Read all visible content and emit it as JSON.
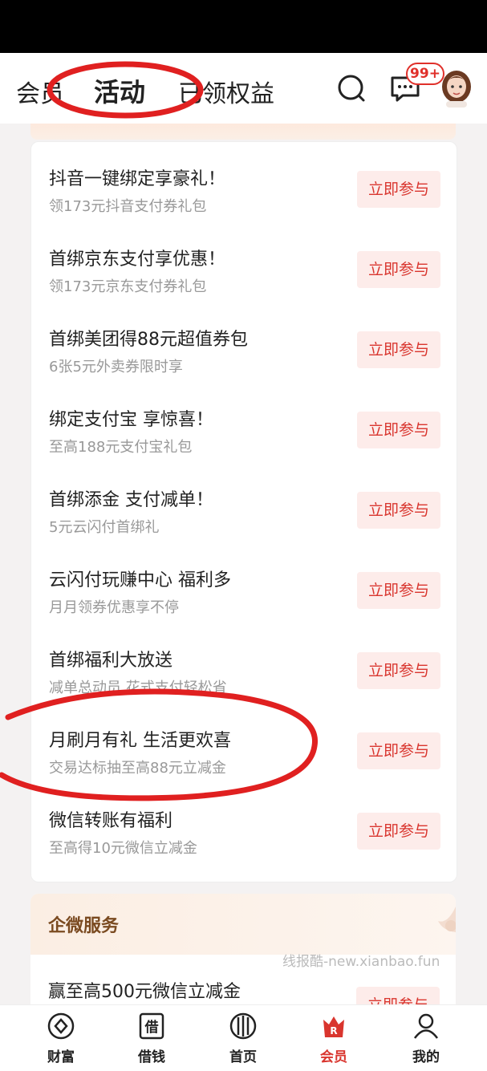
{
  "header": {
    "tabs": [
      {
        "label": "会员"
      },
      {
        "label": "活动"
      },
      {
        "label": "已领权益"
      }
    ],
    "badge": "99+"
  },
  "activities": [
    {
      "title": "抖音一键绑定享豪礼！",
      "subtitle": "领173元抖音支付券礼包",
      "button": "立即参与"
    },
    {
      "title": "首绑京东支付享优惠！",
      "subtitle": "领173元京东支付券礼包",
      "button": "立即参与"
    },
    {
      "title": "首绑美团得88元超值券包",
      "subtitle": "6张5元外卖券限时享",
      "button": "立即参与"
    },
    {
      "title": "绑定支付宝 享惊喜！",
      "subtitle": "至高188元支付宝礼包",
      "button": "立即参与"
    },
    {
      "title": "首绑添金 支付减单！",
      "subtitle": "5元云闪付首绑礼",
      "button": "立即参与"
    },
    {
      "title": "云闪付玩赚中心 福利多",
      "subtitle": "月月领券优惠享不停",
      "button": "立即参与"
    },
    {
      "title": "首绑福利大放送",
      "subtitle": "减单总动员 花式支付轻松省",
      "button": "立即参与"
    },
    {
      "title": "月刷月有礼 生活更欢喜",
      "subtitle": "交易达标抽至高88元立减金",
      "button": "立即参与"
    },
    {
      "title": "微信转账有福利",
      "subtitle": "至高得10元微信立减金",
      "button": "立即参与"
    }
  ],
  "section2": {
    "title": "企微服务",
    "item_title": "赢至高500元微信立减金",
    "item_button": "立即参与"
  },
  "watermark": "线报酷-new.xianbao.fun",
  "bottom_nav": [
    {
      "label": "财富",
      "icon": "wealth-icon"
    },
    {
      "label": "借钱",
      "icon": "borrow-icon"
    },
    {
      "label": "首页",
      "icon": "home-icon"
    },
    {
      "label": "会员",
      "icon": "member-icon"
    },
    {
      "label": "我的",
      "icon": "profile-icon"
    }
  ],
  "colors": {
    "accent": "#d9352e",
    "button_bg": "#fdecea",
    "annotation": "#e02020"
  }
}
